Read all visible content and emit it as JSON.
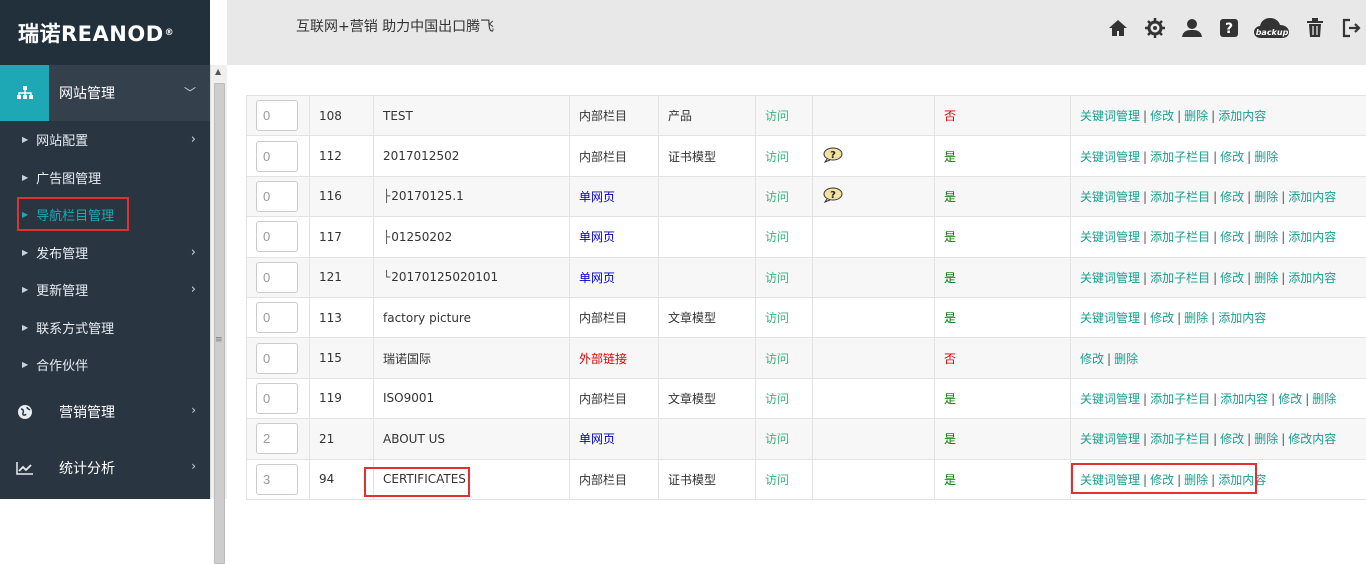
{
  "logo": {
    "text": "瑞诺REANOD",
    "mark": "®"
  },
  "header": {
    "slogan": "互联网+营销  助力中国出口腾飞",
    "icons": [
      "home-icon",
      "settings-icon",
      "user-icon",
      "help-icon",
      "backup-icon",
      "trash-icon",
      "logout-icon"
    ],
    "backup_label": "backup"
  },
  "sidebar": {
    "section1": "网站管理",
    "items": [
      {
        "label": "网站配置",
        "has_children": true
      },
      {
        "label": "广告图管理",
        "has_children": false
      },
      {
        "label": "导航栏目管理",
        "has_children": false
      },
      {
        "label": "发布管理",
        "has_children": true
      },
      {
        "label": "更新管理",
        "has_children": true
      },
      {
        "label": "联系方式管理",
        "has_children": false
      },
      {
        "label": "合作伙伴",
        "has_children": false
      }
    ],
    "section2": "营销管理",
    "section3": "统计分析"
  },
  "table": {
    "visit_label": "访问",
    "rows": [
      {
        "order": "0",
        "id": "108",
        "name": "TEST",
        "prefix": "",
        "type": "内部栏目",
        "type_color": "default",
        "model": "产品",
        "help": false,
        "show": "否",
        "actions": [
          "关键词管理",
          "修改",
          "删除",
          "添加内容"
        ]
      },
      {
        "order": "0",
        "id": "112",
        "name": "2017012502",
        "prefix": "",
        "type": "内部栏目",
        "type_color": "default",
        "model": "证书模型",
        "help": true,
        "show": "是",
        "actions": [
          "关键词管理",
          "添加子栏目",
          "修改",
          "删除"
        ]
      },
      {
        "order": "0",
        "id": "116",
        "name": "20170125.1",
        "prefix": "├",
        "type": "单网页",
        "type_color": "blue",
        "model": "",
        "help": true,
        "show": "是",
        "actions": [
          "关键词管理",
          "添加子栏目",
          "修改",
          "删除",
          "添加内容"
        ]
      },
      {
        "order": "0",
        "id": "117",
        "name": "01250202",
        "prefix": "├",
        "type": "单网页",
        "type_color": "blue",
        "model": "",
        "help": false,
        "show": "是",
        "actions": [
          "关键词管理",
          "添加子栏目",
          "修改",
          "删除",
          "添加内容"
        ]
      },
      {
        "order": "0",
        "id": "121",
        "name": "20170125020101",
        "prefix": "└",
        "type": "单网页",
        "type_color": "blue",
        "model": "",
        "help": false,
        "show": "是",
        "actions": [
          "关键词管理",
          "添加子栏目",
          "修改",
          "删除",
          "添加内容"
        ]
      },
      {
        "order": "0",
        "id": "113",
        "name": "factory picture",
        "prefix": "",
        "type": "内部栏目",
        "type_color": "default",
        "model": "文章模型",
        "help": false,
        "show": "是",
        "actions": [
          "关键词管理",
          "修改",
          "删除",
          "添加内容"
        ]
      },
      {
        "order": "0",
        "id": "115",
        "name": "瑞诺国际",
        "prefix": "",
        "type": "外部链接",
        "type_color": "red",
        "model": "",
        "help": false,
        "show": "否",
        "actions": [
          "修改",
          "删除"
        ]
      },
      {
        "order": "0",
        "id": "119",
        "name": "ISO9001",
        "prefix": "",
        "type": "内部栏目",
        "type_color": "default",
        "model": "文章模型",
        "help": false,
        "show": "是",
        "actions": [
          "关键词管理",
          "添加子栏目",
          "添加内容",
          "修改",
          "删除"
        ]
      },
      {
        "order": "2",
        "id": "21",
        "name": "ABOUT US",
        "prefix": "",
        "type": "单网页",
        "type_color": "blue",
        "model": "",
        "help": false,
        "show": "是",
        "actions": [
          "关键词管理",
          "添加子栏目",
          "修改",
          "删除",
          "修改内容"
        ]
      },
      {
        "order": "3",
        "id": "94",
        "name": "CERTIFICATES",
        "prefix": "",
        "type": "内部栏目",
        "type_color": "default",
        "model": "证书模型",
        "help": false,
        "show": "是",
        "actions": [
          "关键词管理",
          "修改",
          "删除",
          "添加内容"
        ]
      }
    ]
  }
}
